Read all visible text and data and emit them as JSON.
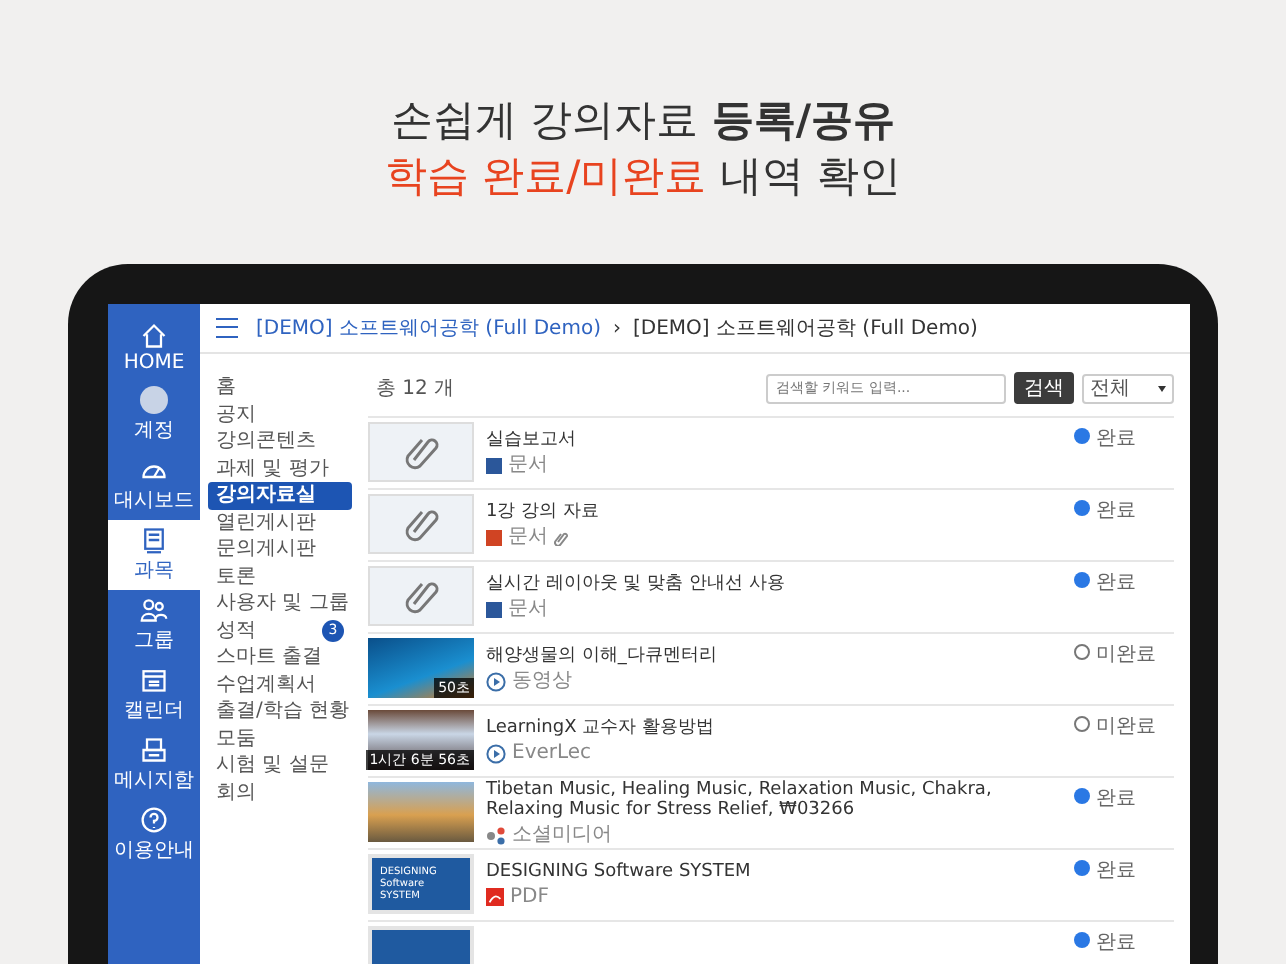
{
  "headline": {
    "line_1": "손쉽게 강의자료 **등록/공유**",
    "line_2_highlight": "학습 완료/미완료",
    "line_2_rest": "내역 확인"
  },
  "rail": [
    {
      "kind": "home",
      "label": "HOME",
      "selected": false
    },
    {
      "kind": "avatar",
      "label": "계정",
      "selected": false
    },
    {
      "kind": "dashboard",
      "label": "대시보드",
      "selected": false
    },
    {
      "kind": "course",
      "label": "과목",
      "selected": true
    },
    {
      "kind": "group",
      "label": "그룹",
      "selected": false
    },
    {
      "kind": "calendar",
      "label": "캘린더",
      "selected": false
    },
    {
      "kind": "inbox",
      "label": "메시지함",
      "selected": false
    },
    {
      "kind": "help",
      "label": "이용안내",
      "selected": false
    }
  ],
  "breadcrumb": {
    "link": "[DEMO] 소프트웨어공학 (Full Demo)",
    "separator": "›",
    "current": "[DEMO] 소프트웨어공학 (Full Demo)"
  },
  "menu": [
    {
      "label": "홈",
      "selected": false
    },
    {
      "label": "공지",
      "selected": false
    },
    {
      "label": "강의콘텐츠",
      "selected": false
    },
    {
      "label": "과제 및 평가",
      "selected": false
    },
    {
      "label": "강의자료실",
      "selected": true
    },
    {
      "label": "열린게시판",
      "selected": false
    },
    {
      "label": "문의게시판",
      "selected": false
    },
    {
      "label": "토론",
      "selected": false
    },
    {
      "label": "사용자 및 그룹",
      "selected": false
    },
    {
      "label": "성적",
      "selected": false,
      "badge": "3"
    },
    {
      "label": "스마트 출결",
      "selected": false
    },
    {
      "label": "수업계획서",
      "selected": false
    },
    {
      "label": "출결/학습 현황",
      "selected": false
    },
    {
      "label": "모둠",
      "selected": false
    },
    {
      "label": "시험 및 설문",
      "selected": false
    },
    {
      "label": "회의",
      "selected": false
    }
  ],
  "toolbar": {
    "count": "총 12 개",
    "search": {
      "placeholder": "검색할 키워드 입력..."
    },
    "search_button": "검색",
    "filter": "전체"
  },
  "items": [
    {
      "thumbnail": {
        "kind": "clipart"
      },
      "title": "실습보고서",
      "kind": "doc",
      "type_label": "문서",
      "attachment": false,
      "completed": true,
      "status": "완료"
    },
    {
      "thumbnail": {
        "kind": "clipart"
      },
      "title": "1강 강의 자료",
      "kind": "ppt",
      "type_label": "문서",
      "attachment": true,
      "completed": true,
      "status": "완료"
    },
    {
      "thumbnail": {
        "kind": "clipart"
      },
      "title": "실시간 레이아웃 및 맞춤 안내선 사용",
      "kind": "doc",
      "type_label": "문서",
      "attachment": false,
      "completed": true,
      "status": "완료"
    },
    {
      "thumbnail": {
        "kind": "ocean",
        "duration": "50초"
      },
      "title": "해양생물의 이해_다큐멘터리",
      "kind": "video",
      "type_label": "동영상",
      "attachment": false,
      "completed": false,
      "status": "미완료"
    },
    {
      "thumbnail": {
        "kind": "screen",
        "duration": "1시간 6분 56초"
      },
      "title": "LearningX 교수자 활용방법",
      "kind": "video",
      "type_label": "EverLec",
      "attachment": false,
      "completed": false,
      "status": "미완료"
    },
    {
      "thumbnail": {
        "kind": "meditation"
      },
      "title": "Tibetan Music, Healing Music, Relaxation Music, Chakra, Relaxing Music for Stress Relief, ₩03266",
      "kind": "social",
      "type_label": "소셜미디어",
      "attachment": false,
      "completed": true,
      "status": "완료"
    },
    {
      "thumbnail": {
        "kind": "slide",
        "slide_title": "DESIGNING Software SYSTEM"
      },
      "title": "DESIGNING Software SYSTEM",
      "kind": "pdf",
      "type_label": "PDF",
      "attachment": false,
      "completed": true,
      "status": "완료"
    },
    {
      "thumbnail": {
        "kind": "slide"
      },
      "completed": true,
      "status": "완료"
    }
  ]
}
